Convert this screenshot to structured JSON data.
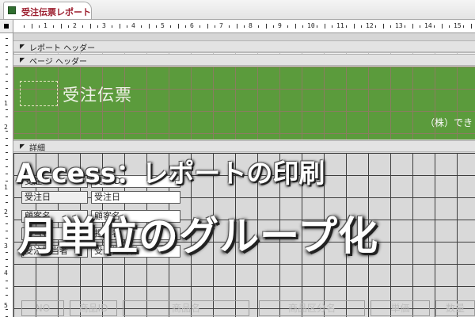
{
  "tab": {
    "icon": "report-icon",
    "label": "受注伝票レポート"
  },
  "ruler": {
    "h_numbers": [
      "1",
      "2",
      "3",
      "4",
      "5",
      "6",
      "7",
      "8",
      "9",
      "10",
      "11",
      "12",
      "13",
      "14",
      "15"
    ],
    "v_header_numbers": [
      "1",
      "2"
    ],
    "v_detail_numbers": [
      "1",
      "2",
      "3",
      "4",
      "5"
    ]
  },
  "sections": {
    "report_header": "レポート ヘッダー",
    "page_header": "ページ ヘッダー",
    "detail": "詳細"
  },
  "page_header": {
    "title": "受注伝票",
    "company": "（株）でき"
  },
  "detail_controls": [
    {
      "label": "受注ID",
      "field": "受注ID"
    },
    {
      "label": "受注日",
      "field": "受注日"
    },
    {
      "label": "顧客名",
      "field": "顧客名"
    },
    {
      "label": "担当者",
      "field": "担当者"
    },
    {
      "label": "受注担当者",
      "field": "受注担当者"
    }
  ],
  "column_headers": [
    "NO",
    "商品ID",
    "商品名",
    "商品区分名",
    "単価",
    "数量"
  ],
  "overlay": {
    "line1": "Access：レポートの印刷",
    "line2": "月単位のグループ化"
  },
  "colors": {
    "header_green": "#5b9b3c",
    "tab_text": "#9b1c2c"
  }
}
